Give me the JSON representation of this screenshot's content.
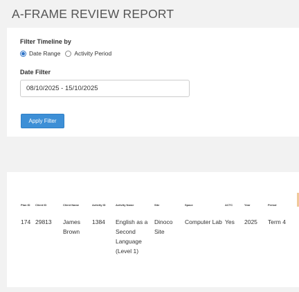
{
  "page": {
    "title": "A-FRAME REVIEW REPORT"
  },
  "filter": {
    "heading": "Filter Timeline by",
    "options": [
      {
        "label": "Date Range",
        "selected": true
      },
      {
        "label": "Activity Period",
        "selected": false
      }
    ],
    "date_label": "Date Filter",
    "date_value": "08/10/2025 - 15/10/2025",
    "apply_label": "Apply Filter"
  },
  "colors": {
    "accent": "#3d8fd6",
    "page_background": "#f2f2f2",
    "card_background": "#ffffff"
  },
  "table": {
    "columns": [
      "Plan ID",
      "Client ID",
      "Client Name",
      "Activity ID",
      "Activity Name",
      "Site",
      "Space",
      "ACTC",
      "Year",
      "Period"
    ],
    "rows": [
      [
        "174",
        "29813",
        "James Brown",
        "1384",
        "English as a Second Language (Level 1)",
        "Dinoco Site",
        "Computer Lab",
        "Yes",
        "2025",
        "Term 4"
      ]
    ]
  }
}
